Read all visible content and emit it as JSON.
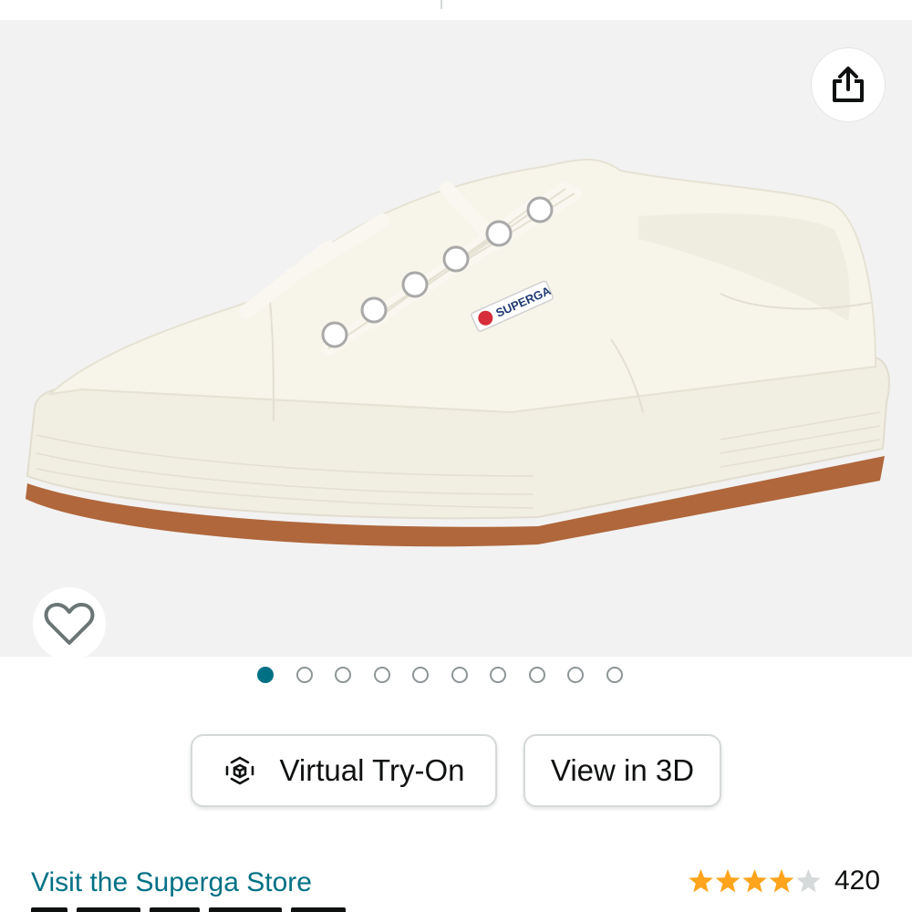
{
  "gallery": {
    "image_alt": "White low-top canvas sneaker",
    "brand_tag": "SUPERGA",
    "share_icon": "share-icon",
    "wishlist_icon": "heart-outline-icon",
    "image_count": 10,
    "active_index": 0
  },
  "actions": {
    "virtual_try_on_label": "Virtual Try-On",
    "virtual_try_on_icon": "ar-cube-icon",
    "view_3d_label": "View in 3D"
  },
  "store": {
    "link_label": "Visit the Superga Store"
  },
  "rating": {
    "stars": 4,
    "max_stars": 5,
    "count": "420"
  },
  "colors": {
    "link": "#007185",
    "active_dot": "#007185",
    "star": "#ffa41c",
    "star_empty": "#d5d9d9"
  }
}
